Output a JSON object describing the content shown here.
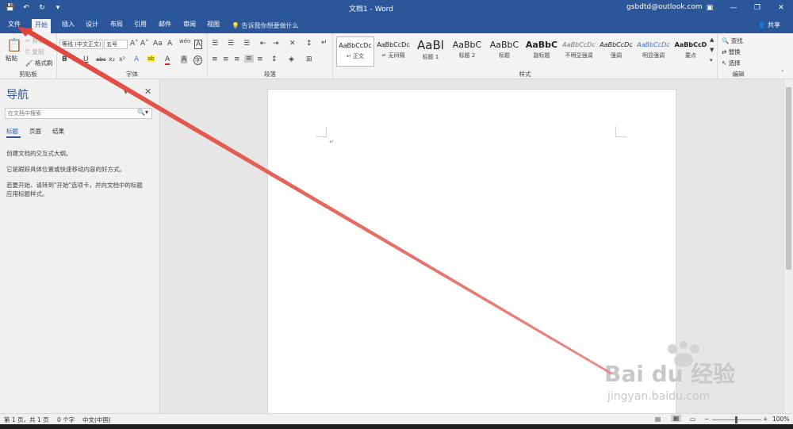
{
  "window": {
    "title": "文档1 - Word",
    "account": "gsbdtd@outlook.com",
    "minimize": "—",
    "restore": "❐",
    "close": "✕"
  },
  "qat": {
    "save": "💾",
    "undo": "↶",
    "redo": "↻",
    "customize": "▾"
  },
  "tabs": [
    {
      "label": "文件"
    },
    {
      "label": "开始"
    },
    {
      "label": "插入"
    },
    {
      "label": "设计"
    },
    {
      "label": "布局"
    },
    {
      "label": "引用"
    },
    {
      "label": "邮件"
    },
    {
      "label": "审阅"
    },
    {
      "label": "视图"
    }
  ],
  "tellme": "告诉我你想要做什么",
  "share": "共享",
  "ribbon": {
    "clipboard": {
      "label": "剪贴板",
      "paste": "粘贴",
      "cut": "剪切",
      "copy": "复制",
      "format_painter": "格式刷"
    },
    "font": {
      "label": "字体",
      "font_name": "等线 (中文正文)",
      "font_size": "五号",
      "bold": "B",
      "italic": "I",
      "underline": "U",
      "strike": "abc",
      "subscript": "x₂",
      "superscript": "x²",
      "grow": "A˄",
      "shrink": "A˅",
      "case": "Aa",
      "clear": "A",
      "phonetic": "wén",
      "border": "A",
      "effects": "A",
      "highlight": "ab",
      "color": "A",
      "shade": "A",
      "enclose": "字"
    },
    "paragraph": {
      "label": "段落"
    },
    "styles": {
      "label": "样式",
      "items": [
        {
          "sample": "AaBbCcDc",
          "name": "↵ 正文"
        },
        {
          "sample": "AaBbCcDc",
          "name": "↵ 无间隔"
        },
        {
          "sample": "AaBl",
          "name": "标题 1"
        },
        {
          "sample": "AaBbC",
          "name": "标题 2"
        },
        {
          "sample": "AaBbC",
          "name": "标题"
        },
        {
          "sample": "AaBbC",
          "name": "副标题"
        },
        {
          "sample": "AaBbCcDc",
          "name": "不明显强调"
        },
        {
          "sample": "AaBbCcDc",
          "name": "强调"
        },
        {
          "sample": "AaBbCcDc",
          "name": "明显强调"
        },
        {
          "sample": "AaBbCcD",
          "name": "要点"
        }
      ]
    },
    "editing": {
      "label": "编辑",
      "find": "查找",
      "replace": "替换",
      "select": "选择"
    }
  },
  "nav": {
    "title": "导航",
    "search_placeholder": "在文档中搜索",
    "tabs": [
      "标题",
      "页面",
      "结果"
    ],
    "line1": "创建文档的交互式大纲。",
    "line2": "它是跟踪具体位置或快速移动内容的好方式。",
    "line3a": "若要开始，请转到\"开始\"选项卡，并向文档中的标题",
    "line3b": "应用标题样式。"
  },
  "status": {
    "page": "第 1 页，共 1 页",
    "words": "0 个字",
    "language": "中文(中国)",
    "zoom": "100%",
    "zoom_minus": "−",
    "zoom_plus": "+"
  },
  "watermark": {
    "main": "Bai du 经验",
    "sub": "jingyan.baidu.com"
  },
  "colors": {
    "brand": "#2b579a",
    "arrow": "#e0443a"
  }
}
